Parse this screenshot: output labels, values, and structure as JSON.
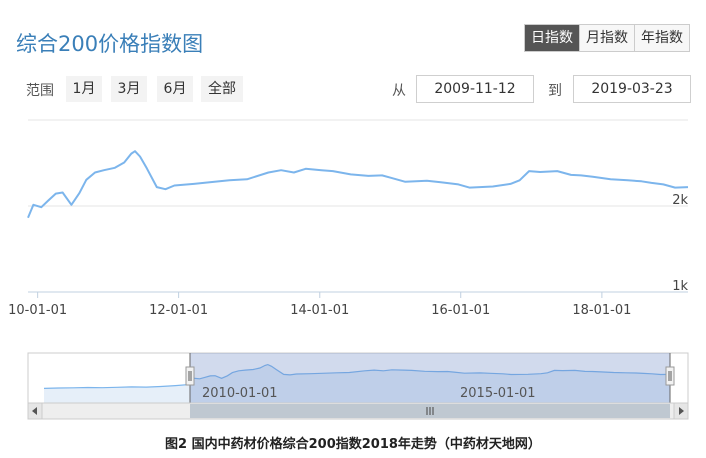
{
  "title": "综合200价格指数图",
  "period_buttons": [
    {
      "label": "日指数",
      "active": true
    },
    {
      "label": "月指数",
      "active": false
    },
    {
      "label": "年指数",
      "active": false
    }
  ],
  "range": {
    "label": "范围",
    "buttons": [
      "1月",
      "3月",
      "6月",
      "全部"
    ]
  },
  "date_range": {
    "from_label": "从",
    "from": "2009-11-12",
    "to_label": "到",
    "to": "2019-03-23"
  },
  "navigator": {
    "tick_labels": [
      "2010-01-01",
      "2015-01-01"
    ],
    "scroll_left_icon": "arrow-left-icon",
    "scroll_right_icon": "arrow-right-icon",
    "scroll_thumb_icon": "grip-icon"
  },
  "caption": "图2   国内中药材价格综合200指数2018年走势（中药材天地网）",
  "colors": {
    "line": "#7cb5ec",
    "navigator_fill": "#d5e4f5",
    "navigator_mask": "rgba(102,133,194,0.3)",
    "active_button": "#555555",
    "title": "#3a7fb8"
  },
  "chart_data": {
    "type": "line",
    "x_axis_type": "datetime",
    "y_scale": "log",
    "grid": true,
    "legend": "none",
    "xlim": [
      "2009-11-12",
      "2019-03-23"
    ],
    "ylim": [
      1000,
      4000
    ],
    "y_ticks": [
      {
        "value": 2000,
        "label": "2k"
      },
      {
        "value": 1000,
        "label": "1k"
      }
    ],
    "x_ticks": [
      {
        "value": "2010-01-01",
        "label": "10-01-01"
      },
      {
        "value": "2012-01-01",
        "label": "12-01-01"
      },
      {
        "value": "2014-01-01",
        "label": "14-01-01"
      },
      {
        "value": "2016-01-01",
        "label": "16-01-01"
      },
      {
        "value": "2018-01-01",
        "label": "18-01-01"
      }
    ],
    "series": [
      {
        "x": [
          "2009-11-12",
          "2009-12-10",
          "2010-01-20",
          "2010-02-25",
          "2010-04-05",
          "2010-05-10",
          "2010-06-25",
          "2010-08-05",
          "2010-09-10",
          "2010-10-25",
          "2010-12-10",
          "2011-02-05",
          "2011-03-25",
          "2011-05-01",
          "2011-05-20",
          "2011-06-15",
          "2011-07-20",
          "2011-09-10",
          "2011-10-25",
          "2011-12-10",
          "2012-03-20",
          "2012-06-10",
          "2012-09-20",
          "2012-12-20",
          "2013-04-10",
          "2013-06-15",
          "2013-08-20",
          "2013-10-20",
          "2014-01-10",
          "2014-03-10",
          "2014-06-10",
          "2014-09-10",
          "2014-11-20",
          "2015-01-05",
          "2015-03-20",
          "2015-07-10",
          "2015-09-20",
          "2015-12-20",
          "2016-02-15",
          "2016-06-15",
          "2016-09-15",
          "2016-11-01",
          "2016-12-20",
          "2017-02-15",
          "2017-05-15",
          "2017-07-25",
          "2017-09-15",
          "2017-11-15",
          "2018-02-15",
          "2018-05-15",
          "2018-07-25",
          "2018-09-15",
          "2018-11-15",
          "2019-01-15",
          "2019-03-23"
        ],
        "values": [
          1820,
          2020,
          1980,
          2090,
          2210,
          2230,
          2020,
          2220,
          2470,
          2620,
          2670,
          2720,
          2840,
          3050,
          3110,
          2980,
          2710,
          2330,
          2290,
          2360,
          2390,
          2420,
          2460,
          2480,
          2620,
          2670,
          2620,
          2700,
          2670,
          2650,
          2580,
          2550,
          2560,
          2510,
          2430,
          2450,
          2420,
          2380,
          2320,
          2340,
          2390,
          2460,
          2650,
          2630,
          2650,
          2570,
          2560,
          2530,
          2480,
          2460,
          2440,
          2410,
          2380,
          2320,
          2330
        ]
      }
    ]
  }
}
